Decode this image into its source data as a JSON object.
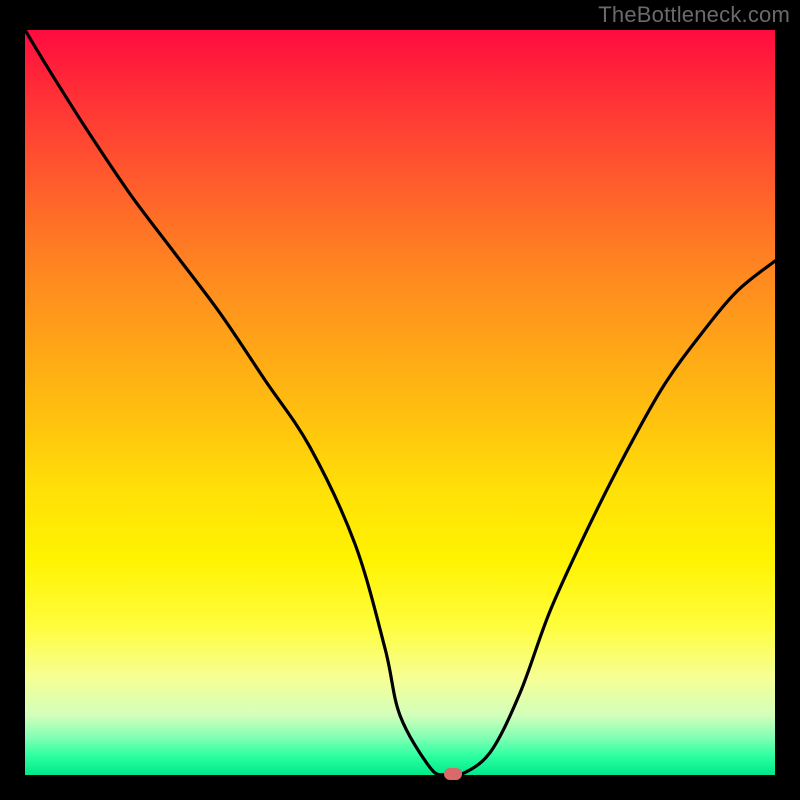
{
  "watermark": {
    "text": "TheBottleneck.com"
  },
  "chart_data": {
    "type": "line",
    "title": "",
    "xlabel": "",
    "ylabel": "",
    "xlim": [
      0,
      100
    ],
    "ylim": [
      0,
      100
    ],
    "grid": false,
    "legend": false,
    "background": "vertical-gradient red→yellow→green",
    "series": [
      {
        "name": "bottleneck-curve",
        "x": [
          0,
          3,
          8,
          14,
          20,
          26,
          32,
          38,
          44,
          48,
          50,
          54,
          56,
          58,
          62,
          66,
          70,
          75,
          80,
          85,
          90,
          95,
          100
        ],
        "values": [
          100,
          95,
          87,
          78,
          70,
          62,
          53,
          44,
          31,
          17,
          8,
          1,
          0,
          0,
          3,
          11,
          22,
          33,
          43,
          52,
          59,
          65,
          69
        ]
      }
    ],
    "marker": {
      "x": 57,
      "y": 0,
      "label": "",
      "color": "#d96a6a"
    }
  },
  "colors": {
    "frame": "#000000",
    "curve": "#000000",
    "marker": "#d96a6a",
    "watermark": "#6a6a6a"
  }
}
